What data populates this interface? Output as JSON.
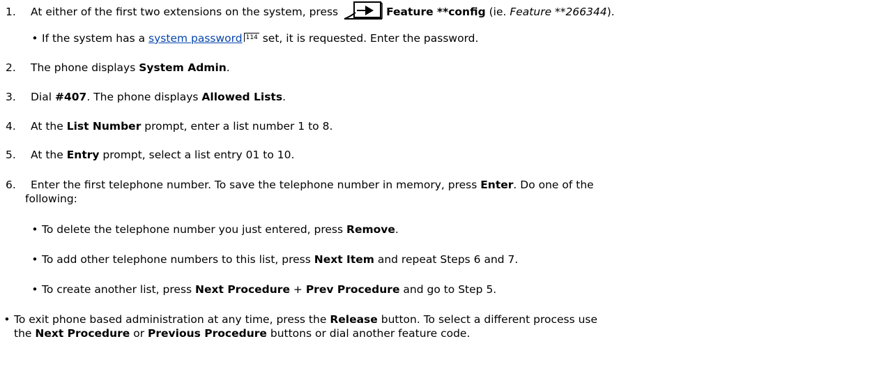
{
  "steps": [
    {
      "number": "1.",
      "text_a": "At either of the first two extensions on the system, press ",
      "bold_a": "Feature **config",
      "text_b": " (ie. ",
      "italic_a": "Feature **266344",
      "text_c": ")."
    },
    {
      "number": "2.",
      "text_a": "The phone displays ",
      "bold_a": "System Admin",
      "text_b": "."
    },
    {
      "number": "3.",
      "text_a": "Dial ",
      "bold_a": "#407",
      "text_b": ". The phone displays ",
      "bold_b": "Allowed Lists",
      "text_c": "."
    },
    {
      "number": "4.",
      "text_a": "At the ",
      "bold_a": "List Number",
      "text_b": " prompt, enter a list number 1 to 8."
    },
    {
      "number": "5.",
      "text_a": "At the ",
      "bold_a": "Entry",
      "text_b": " prompt, select a list entry 01 to 10."
    },
    {
      "number": "6.",
      "text_a": "Enter the first telephone number. To save the telephone number in memory, press ",
      "bold_a": "Enter",
      "text_b": ".  Do one of the",
      "text_line2": "following:"
    }
  ],
  "step1_sub": {
    "text_a": "If the system has a ",
    "link": "system password",
    "pageref": "114",
    "text_b": " set, it is requested. Enter the password."
  },
  "step6_subs": [
    {
      "text_a": "To delete the telephone number you just entered, press ",
      "bold_a": "Remove",
      "text_b": "."
    },
    {
      "text_a": "To add other telephone numbers to this list, press ",
      "bold_a": "Next Item",
      "text_b": " and repeat Steps 6 and 7."
    },
    {
      "text_a": "To create another list, press ",
      "bold_a": "Next Procedure",
      "text_b": " + ",
      "bold_b": "Prev Procedure",
      "text_c": " and go to Step 5."
    }
  ],
  "final_note": {
    "text_a": "To exit phone based administration at any time, press the ",
    "bold_a": "Release",
    "text_b": " button. To select a different process use",
    "text_line2_a": "the ",
    "bold_b": "Next Procedure",
    "text_line2_b": " or ",
    "bold_c": "Previous Procedure",
    "text_line2_c": " buttons or dial another feature code."
  },
  "bullet_glyph": "•",
  "icons": {
    "feature_key": "feature-arrow-key-icon"
  }
}
